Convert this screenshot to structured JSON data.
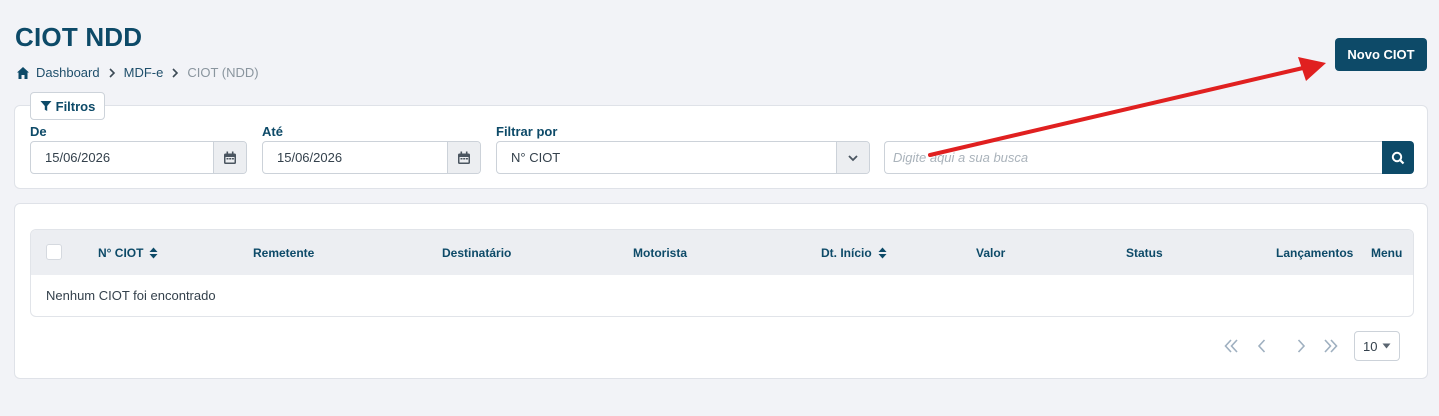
{
  "header": {
    "title": "CIOT NDD",
    "new_button_label": "Novo CIOT"
  },
  "breadcrumb": {
    "items": [
      "Dashboard",
      "MDF-e",
      "CIOT (NDD)"
    ]
  },
  "filters": {
    "tab_label": "Filtros",
    "from_label": "De",
    "from_value": "15/06/2026",
    "to_label": "Até",
    "to_value": "15/06/2026",
    "filter_by_label": "Filtrar por",
    "filter_by_value": "N° CIOT",
    "search_placeholder": "Digite aqui a sua busca"
  },
  "table": {
    "columns": [
      "N° CIOT",
      "Remetente",
      "Destinatário",
      "Motorista",
      "Dt. Início",
      "Valor",
      "Status",
      "Lançamentos",
      "Menu"
    ],
    "empty_message": "Nenhum CIOT foi encontrado"
  },
  "pagination": {
    "page_size": "10"
  },
  "colors": {
    "brand": "#0d4a68",
    "background": "#f2f3f7",
    "annotation_arrow": "#e02020"
  },
  "icons": {
    "home": "home-icon",
    "filter": "filter-icon",
    "calendar": "calendar-icon",
    "chevron_down": "chevron-down-icon",
    "search": "search-icon",
    "sort": "sort-icon",
    "first": "first-page-icon",
    "prev": "prev-page-icon",
    "next": "next-page-icon",
    "last": "last-page-icon"
  }
}
